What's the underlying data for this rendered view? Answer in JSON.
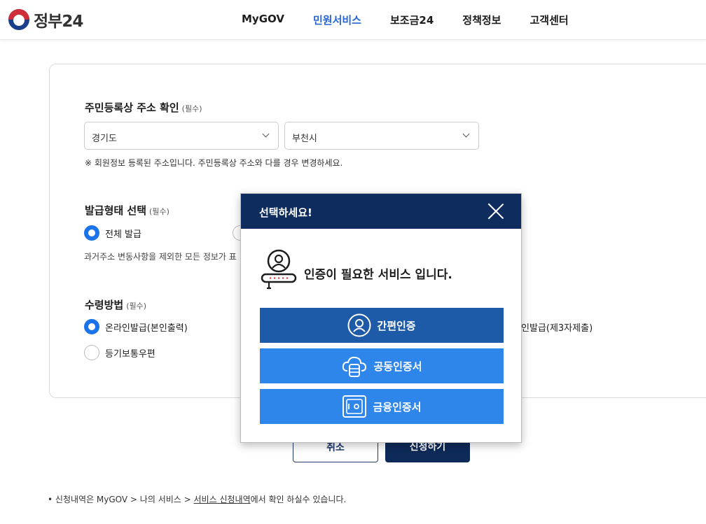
{
  "header": {
    "logo_text": "정부24",
    "nav": [
      "MyGOV",
      "민원서비스",
      "보조금24",
      "정책정보",
      "고객센터"
    ],
    "active_nav": "민원서비스"
  },
  "form": {
    "address": {
      "title": "주민등록상 주소 확인",
      "required": "(필수)",
      "province": "경기도",
      "city": "부천시",
      "note": "※ 회원정보 등록된 주소입니다. 주민등록상 주소와 다를 경우 변경하세요."
    },
    "issue_type": {
      "title": "발급형태 선택",
      "required": "(필수)",
      "option_all": "전체 발급",
      "desc": "과거주소 변동사항을 제외한 모든 정보가 표"
    },
    "receive": {
      "title": "수령방법",
      "required": "(필수)",
      "option_online": "온라인발급(본인출력)",
      "option_mail": "등기보통우편",
      "option_third_partial": "인발급(제3자제출)"
    },
    "cancel_label": "취소",
    "apply_label": "신청하기"
  },
  "footer": {
    "bullet": "•",
    "text_pre": "신청내역은 MyGOV > 나의 서비스 > ",
    "link": "서비스 신청내역",
    "text_post": "에서 확인 하실수 있습니다."
  },
  "modal": {
    "title": "선택하세요!",
    "message": "인증이 필요한 서비스 입니다.",
    "buttons": [
      "간편인증",
      "공동인증서",
      "금융인증서"
    ]
  },
  "colors": {
    "navy": "#0e2c5e",
    "accent_blue": "#2867d8",
    "button_blue": "#2f86ea",
    "button_dark_blue": "#1d5aa8"
  }
}
